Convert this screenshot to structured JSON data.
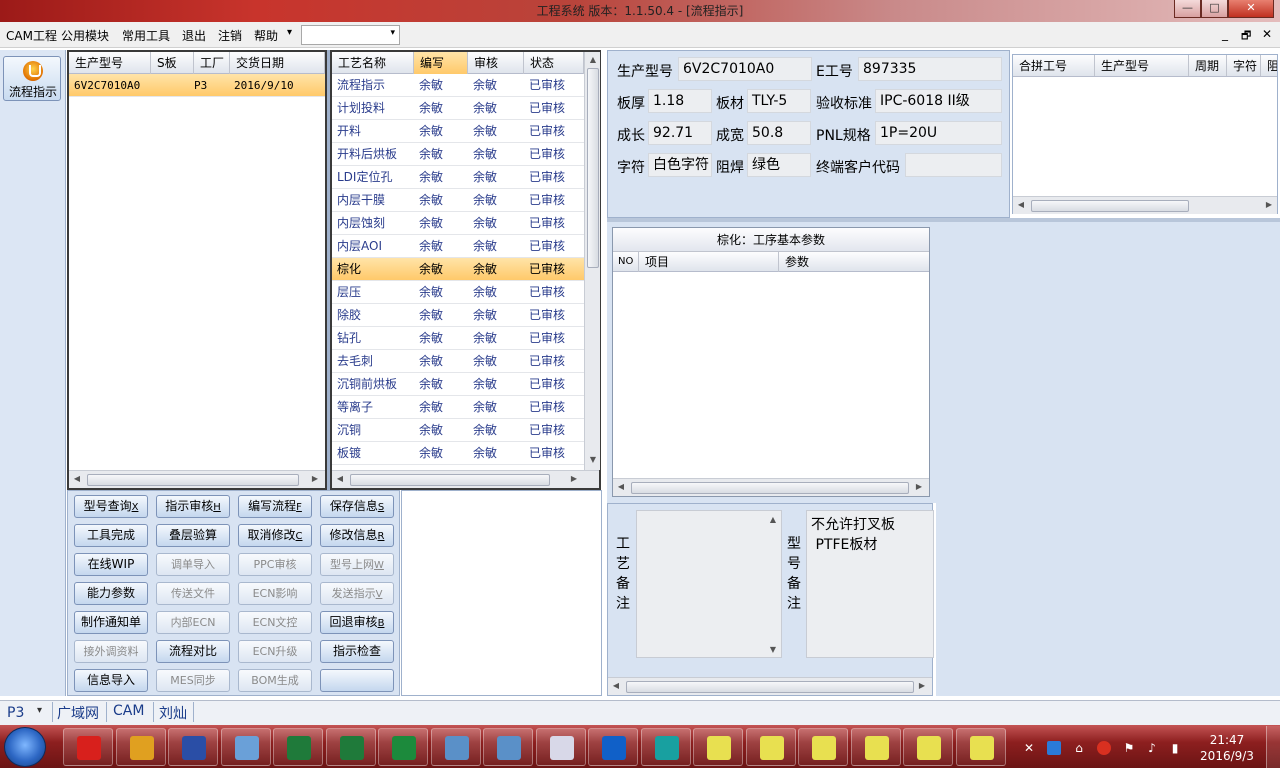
{
  "window": {
    "title": "工程系统   版本：1.1.50.4 - [流程指示]",
    "min": "—",
    "max": "□",
    "close": "✕"
  },
  "menu": {
    "items": [
      "CAM工程",
      "公用模块",
      "常用工具",
      "退出",
      "注销",
      "帮助"
    ],
    "help_arrow": "▾",
    "combo_value": "",
    "combo_arrow": "▾",
    "mdi": [
      "_",
      "🗗",
      "✕"
    ]
  },
  "nav": {
    "label": "流程指示"
  },
  "orders": {
    "columns": [
      "生产型号",
      "S板",
      "工厂",
      "交货日期"
    ],
    "rows": [
      {
        "model": "6V2C7010A0",
        "s": "",
        "factory": "P3",
        "date": "2016/9/10"
      }
    ]
  },
  "process": {
    "columns": [
      "工艺名称",
      "编写",
      "审核",
      "状态"
    ],
    "selected_index": 8,
    "rows": [
      {
        "name": "流程指示",
        "writer": "余敏",
        "reviewer": "余敏",
        "status": "已审核"
      },
      {
        "name": "计划投料",
        "writer": "余敏",
        "reviewer": "余敏",
        "status": "已审核"
      },
      {
        "name": "开料",
        "writer": "余敏",
        "reviewer": "余敏",
        "status": "已审核"
      },
      {
        "name": "开料后烘板",
        "writer": "余敏",
        "reviewer": "余敏",
        "status": "已审核"
      },
      {
        "name": "LDI定位孔",
        "writer": "余敏",
        "reviewer": "余敏",
        "status": "已审核"
      },
      {
        "name": "内层干膜",
        "writer": "余敏",
        "reviewer": "余敏",
        "status": "已审核"
      },
      {
        "name": "内层蚀刻",
        "writer": "余敏",
        "reviewer": "余敏",
        "status": "已审核"
      },
      {
        "name": "内层AOI",
        "writer": "余敏",
        "reviewer": "余敏",
        "status": "已审核"
      },
      {
        "name": "棕化",
        "writer": "余敏",
        "reviewer": "余敏",
        "status": "已审核"
      },
      {
        "name": "层压",
        "writer": "余敏",
        "reviewer": "余敏",
        "status": "已审核"
      },
      {
        "name": "除胶",
        "writer": "余敏",
        "reviewer": "余敏",
        "status": "已审核"
      },
      {
        "name": "钻孔",
        "writer": "余敏",
        "reviewer": "余敏",
        "status": "已审核"
      },
      {
        "name": "去毛刺",
        "writer": "余敏",
        "reviewer": "余敏",
        "status": "已审核"
      },
      {
        "name": "沉铜前烘板",
        "writer": "余敏",
        "reviewer": "余敏",
        "status": "已审核"
      },
      {
        "name": "等离子",
        "writer": "余敏",
        "reviewer": "余敏",
        "status": "已审核"
      },
      {
        "name": "沉铜",
        "writer": "余敏",
        "reviewer": "余敏",
        "status": "已审核"
      },
      {
        "name": "板镀",
        "writer": "余敏",
        "reviewer": "余敏",
        "status": "已审核"
      }
    ]
  },
  "buttons": [
    [
      {
        "label": "型号查询",
        "key": "X",
        "enabled": true
      },
      {
        "label": "指示审核",
        "key": "H",
        "enabled": true
      },
      {
        "label": "编写流程",
        "key": "F",
        "enabled": true
      },
      {
        "label": "保存信息",
        "key": "S",
        "enabled": true
      }
    ],
    [
      {
        "label": "工具完成",
        "key": "",
        "enabled": true
      },
      {
        "label": "叠层验算",
        "key": "",
        "enabled": true
      },
      {
        "label": "取消修改",
        "key": "C",
        "enabled": true
      },
      {
        "label": "修改信息",
        "key": "R",
        "enabled": true
      }
    ],
    [
      {
        "label": "在线WIP",
        "key": "",
        "enabled": true
      },
      {
        "label": "调单导入",
        "key": "",
        "enabled": false
      },
      {
        "label": "PPC审核",
        "key": "",
        "enabled": false
      },
      {
        "label": "型号上网",
        "key": "W",
        "enabled": false
      }
    ],
    [
      {
        "label": "能力参数",
        "key": "",
        "enabled": true
      },
      {
        "label": "传送文件",
        "key": "",
        "enabled": false
      },
      {
        "label": "ECN影响",
        "key": "",
        "enabled": false
      },
      {
        "label": "发送指示",
        "key": "V",
        "enabled": false
      }
    ],
    [
      {
        "label": "制作通知单",
        "key": "",
        "enabled": true
      },
      {
        "label": "内部ECN",
        "key": "",
        "enabled": false
      },
      {
        "label": "ECN文控",
        "key": "",
        "enabled": false
      },
      {
        "label": "回退审核",
        "key": "B",
        "enabled": true
      }
    ],
    [
      {
        "label": "接外调资料",
        "key": "",
        "enabled": false
      },
      {
        "label": "流程对比",
        "key": "",
        "enabled": true
      },
      {
        "label": "ECN升级",
        "key": "",
        "enabled": false
      },
      {
        "label": "指示检查",
        "key": "",
        "enabled": true
      }
    ],
    [
      {
        "label": "信息导入",
        "key": "",
        "enabled": true
      },
      {
        "label": "MES同步",
        "key": "",
        "enabled": false
      },
      {
        "label": "BOM生成",
        "key": "",
        "enabled": false
      },
      {
        "label": "",
        "key": "",
        "enabled": true
      }
    ]
  ],
  "info": {
    "model_label": "生产型号",
    "model": "6V2C7010A0",
    "e_label": "E工号",
    "e_no": "897335",
    "thickness_label": "板厚",
    "thickness": "1.18",
    "material_label": "板材",
    "material": "TLY-5",
    "standard_label": "验收标准",
    "standard": "IPC-6018 II级",
    "length_label": "成长",
    "length": "92.71",
    "width_label": "成宽",
    "width": "50.8",
    "pnl_label": "PNL规格",
    "pnl": "1P=20U",
    "char_label": "字符",
    "char": "白色字符",
    "mask_label": "阻焊",
    "mask": "绿色",
    "cust_label": "终端客户代码",
    "cust": ""
  },
  "merge": {
    "columns": [
      "合拼工号",
      "生产型号",
      "周期",
      "字符",
      "阻焊"
    ]
  },
  "params": {
    "title": "棕化：工序基本参数",
    "columns": [
      "NO",
      "项目",
      "参数"
    ]
  },
  "notes": {
    "process_label": "工艺备注",
    "model_label": "型号备注",
    "model_notes": [
      "不允许打叉板",
      " PTFE板材"
    ]
  },
  "status": {
    "factory": "P3",
    "arrow": "▾",
    "network": "广域网",
    "module": "CAM",
    "user": "刘灿"
  },
  "taskbar": {
    "time": "21:47",
    "date": "2016/9/3",
    "apps": [
      {
        "name": "redflag",
        "color": "#d8201c"
      },
      {
        "name": "shell",
        "color": "#e0a020"
      },
      {
        "name": "save",
        "color": "#2a4ea6"
      },
      {
        "name": "notepad",
        "color": "#6aa0d8"
      },
      {
        "name": "excel",
        "color": "#1f7a3a"
      },
      {
        "name": "excel2",
        "color": "#1f7a3a"
      },
      {
        "name": "p-app",
        "color": "#1c8a3c"
      },
      {
        "name": "picture",
        "color": "#5a90c8"
      },
      {
        "name": "picture2",
        "color": "#5a90c8"
      },
      {
        "name": "text-editor",
        "color": "#d8d8e8"
      },
      {
        "name": "f-app",
        "color": "#1060c8"
      },
      {
        "name": "eye-app",
        "color": "#18a0a0"
      },
      {
        "name": "win1",
        "color": "#e8e050"
      },
      {
        "name": "win2",
        "color": "#e8e050"
      },
      {
        "name": "win3",
        "color": "#e8e050"
      },
      {
        "name": "win4",
        "color": "#e8e050"
      },
      {
        "name": "win5",
        "color": "#e8e050"
      },
      {
        "name": "win6",
        "color": "#e8e050"
      }
    ]
  }
}
